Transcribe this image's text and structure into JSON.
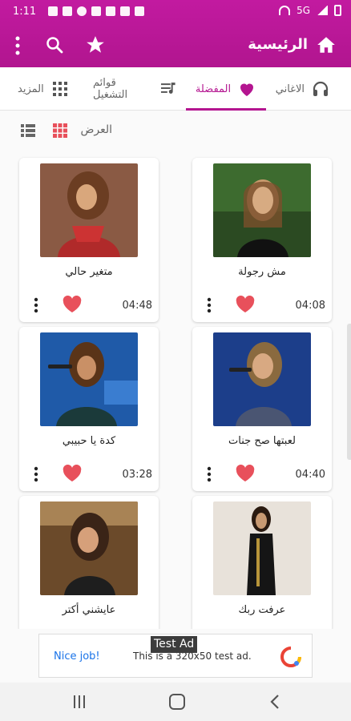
{
  "status_bar": {
    "time": "1:11",
    "network": "5G"
  },
  "app_bar": {
    "title": "الرئيسية"
  },
  "tabs": [
    {
      "label": "الاغاني",
      "icon": "headphones-icon"
    },
    {
      "label": "المفضلة",
      "icon": "heart-icon",
      "active": true
    },
    {
      "label": "قوائم التشغيل",
      "icon": "playlist-icon"
    },
    {
      "label": "المزيد",
      "icon": "apps-grid-icon"
    }
  ],
  "view": {
    "label": "العرض"
  },
  "songs": [
    {
      "title": "مش رجولة",
      "duration": "04:08"
    },
    {
      "title": "متغير حالي",
      "duration": "04:48"
    },
    {
      "title": "لعبتها صح جنات",
      "duration": "04:40"
    },
    {
      "title": "كدة يا حبيبي",
      "duration": "03:28"
    },
    {
      "title": "عرفت ربك",
      "duration": ""
    },
    {
      "title": "عايشني أكتر",
      "duration": ""
    }
  ],
  "ad": {
    "badge": "Test Ad",
    "nice": "Nice job!",
    "text": "This is a 320x50 test ad."
  },
  "colors": {
    "accent": "#b41590",
    "heart": "#e8505b"
  }
}
